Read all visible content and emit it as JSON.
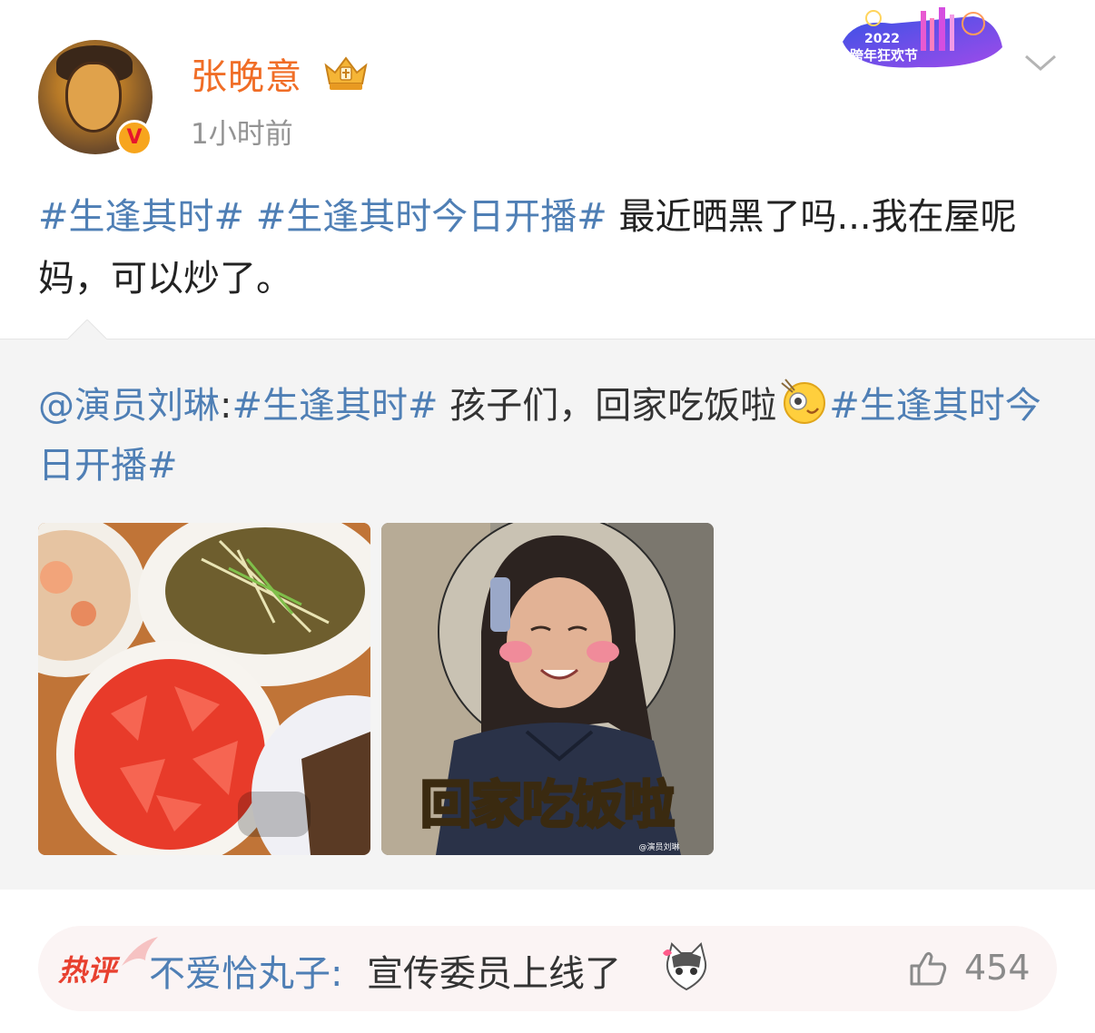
{
  "post": {
    "username": "张晚意",
    "timestamp": "1小时前",
    "text_topic_1": "#生逢其时#",
    "text_topic_2": "#生逢其时今日开播#",
    "text_body": " 最近晒黑了吗...我在屋呢妈，可以炒了。",
    "verified_badge": "V",
    "badge_icon": "crown-icon",
    "banner_year": "2022",
    "banner_text": "跨年狂欢节"
  },
  "repost": {
    "author_link": "@演员刘琳",
    "separator": ":",
    "topic_1": "#生逢其时#",
    "body": " 孩子们，回家吃饭啦",
    "topic_2": "#生逢其时今日开播#",
    "emoji": "chan-emoji",
    "image_2_caption": "回家吃饭啦",
    "image_2_watermark": "@演员刘琳"
  },
  "hot_comment": {
    "label": "热评",
    "commenter": "不爱恰丸子",
    "separator": ": ",
    "text": "宣传委员上线了",
    "likes": "454"
  },
  "colors": {
    "accent_orange": "#f06d26",
    "link_blue": "#4f7fb5",
    "hot_red": "#e8402f"
  }
}
